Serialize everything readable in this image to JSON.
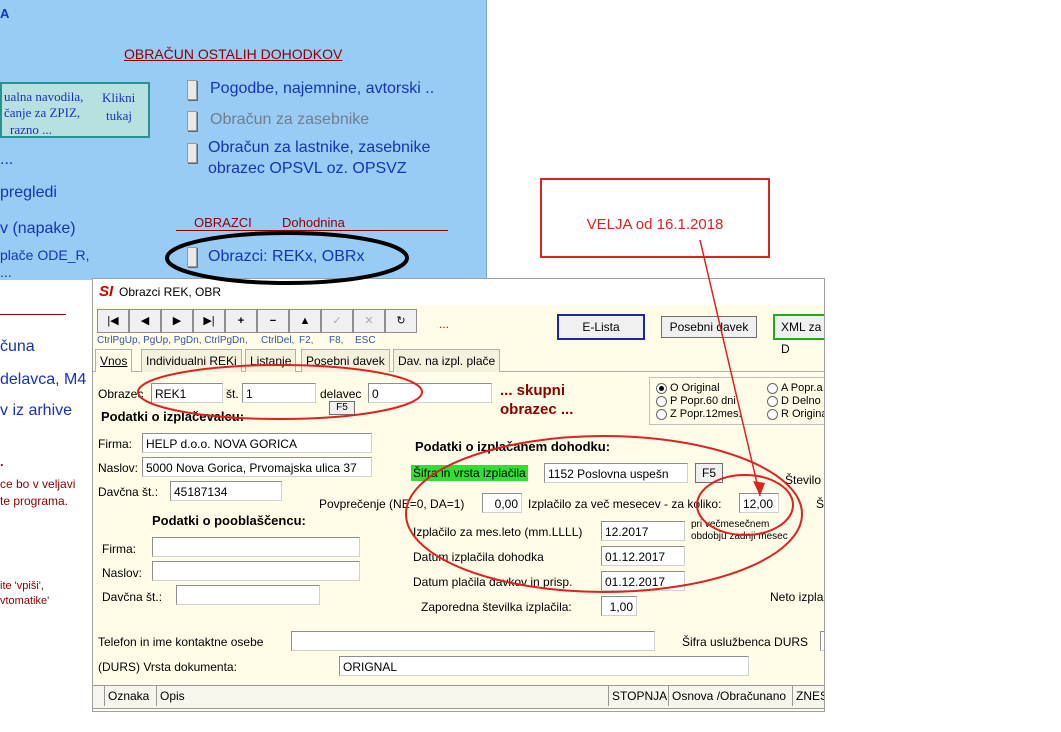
{
  "background_panel": {
    "heading": "OBRAČUN OSTALIH DOHODKOV",
    "help_box_lines": [
      "ualna navodila,",
      "čanje za ZPIZ,",
      "razno ..."
    ],
    "help_box_link": [
      "Klikni",
      "tukaj"
    ],
    "menu_items": [
      {
        "label": "Pogodbe, najemnine, avtorski ..",
        "enabled": true
      },
      {
        "label": "Obračun za zasebnike",
        "enabled": false
      },
      {
        "label_line1": "Obračun za lastnike, zasebnike",
        "label_line2": "obrazec OPSVL oz. OPSVZ",
        "enabled": true
      }
    ],
    "heading2_left": "OBRAZCI",
    "heading2_right": "Dohodnina",
    "forms_item": "Obrazci: REKx, OBRx",
    "left_fragments": [
      "...",
      "pregledi",
      "v (napake)",
      "plače ODE_R,",
      "...",
      "čuna",
      "delavca, M4",
      "v iz arhive"
    ],
    "left_small_text": [
      "ce bo v veljavi",
      "te programa.",
      "ite 'vpiši',",
      "vtomatike'"
    ]
  },
  "annotation": {
    "callout_text": "VELJA od 16.1.2018",
    "note_text_line1": "... skupni",
    "note_text_line2": "obrazec ..."
  },
  "window": {
    "title": "Obrazci REK, OBR",
    "toolbar": {
      "buttons": [
        "|◀",
        "◀",
        "▶",
        "▶|",
        "+",
        "−",
        "▲",
        "✓",
        "✕",
        "↻"
      ],
      "labels": [
        "CtrlPgUp, PgUp, PgDn, CtrlPgDn,",
        "CtrlDel,",
        "F2,",
        "F8,",
        "ESC"
      ],
      "dots": "...",
      "elista_button": "E-Lista",
      "posebni_button": "Posebni davek",
      "xml_button": "XML za D"
    },
    "tabs": [
      "Vnos",
      "Individualni REKi",
      "Listanje",
      "Posebni davek",
      "Dav. na izpl. plače"
    ],
    "form": {
      "obrazec_label": "Obrazec",
      "obrazec_value": "REK1",
      "st_label": "št.",
      "st_value": "1",
      "delavec_label": "delavec",
      "delavec_value": "0",
      "f5_label": "F5",
      "izplacevalec_title": "Podatki o izplačevalcu:",
      "firma_label": "Firma:",
      "firma_value": "HELP d.o.o. NOVA GORICA",
      "naslov_label": "Naslov:",
      "naslov_value": "5000 Nova Gorica, Prvomajska ulica 37",
      "davcna_label": "Davčna št.:",
      "davcna_value": "45187134",
      "pooblascenec_title": "Podatki o pooblaščencu:",
      "p_firma_label": "Firma:",
      "p_firma_value": "",
      "p_naslov_label": "Naslov:",
      "p_naslov_value": "",
      "p_davcna_label": "Davčna št.:",
      "p_davcna_value": "",
      "dohodek_title": "Podatki o izplačanem dohodku:",
      "sifra_label": "Šifra in vrsta izplačila",
      "sifra_value": "1152 Poslovna uspešn",
      "sifra_f5": "F5",
      "stevilo_label": "Število",
      "povprecenje_label": "Povprečenje (NE=0, DA=1)",
      "povprecenje_value": "0,00",
      "vec_mesecev_label": "Izplačilo za več mesecev - za koliko:",
      "vec_mesecev_value": "12,00",
      "s_label": "Š",
      "mes_leto_label": "Izplačilo za mes.leto (mm.LLLL)",
      "mes_leto_value": "12.2017",
      "vecmes_note_line1": "pri večmesečnem",
      "vecmes_note_line2": "obdobju zadnji mesec",
      "datum_izpl_label": "Datum izplačila dohodka",
      "datum_izpl_value": "01.12.2017",
      "datum_plac_label": "Datum plačila davkov in prisp.",
      "datum_plac_value": "01.12.2017",
      "neto_label": "Neto izpla",
      "zaporedna_label": "Zaporedna številka izplačila:",
      "zaporedna_value": "1,00",
      "telefon_label": "Telefon in ime kontaktne osebe",
      "telefon_value": "",
      "sifra_usl_label": "Šifra uslužbenca DURS",
      "vrsta_dok_label": "(DURS) Vrsta dokumenta:",
      "vrsta_dok_value": "ORIGNAL"
    },
    "radio_options": [
      {
        "label": "O Original",
        "selected": true
      },
      {
        "label": "P Popr.60 dni",
        "selected": false
      },
      {
        "label": "Z Popr.12mes.",
        "selected": false
      },
      {
        "label": "A Popr.a",
        "selected": false
      },
      {
        "label": "D Delno p",
        "selected": false
      },
      {
        "label": "R Origina",
        "selected": false
      }
    ],
    "table_headers": [
      "Oznaka",
      "Opis",
      "STOPNJA",
      "Osnova /Obračunano",
      "ZNES"
    ]
  },
  "colors": {
    "panel_bg": "#99ccf4",
    "window_bg": "#fffde8",
    "highlight_green": "#33dd33",
    "annotation_red": "#dd2222",
    "annotation_black": "#000000"
  }
}
